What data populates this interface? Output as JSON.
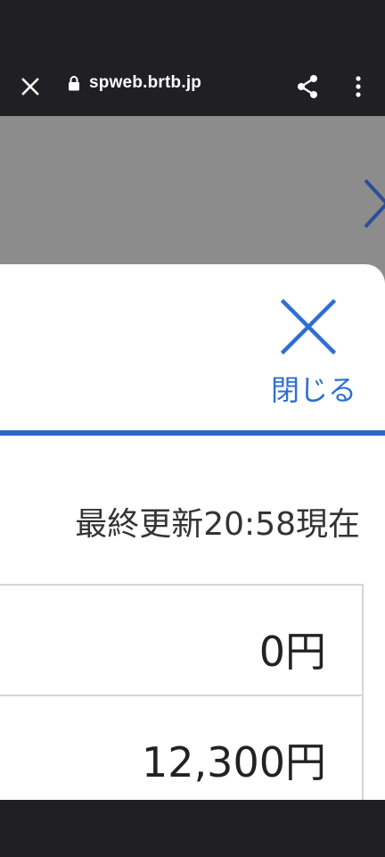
{
  "browser": {
    "url": "spweb.brtb.jp",
    "close_icon": "close-icon",
    "lock_icon": "lock-icon",
    "share_icon": "share-icon",
    "menu_icon": "more-vert-icon"
  },
  "background": {
    "chevron_icon": "chevron-right-icon"
  },
  "sheet": {
    "close_label": "閉じる",
    "last_updated": "最終更新20:58現在",
    "rows": [
      {
        "amount": "0円"
      },
      {
        "amount": "12,300円"
      }
    ]
  },
  "colors": {
    "accent": "#2f66c9",
    "chrome": "#1f1f24",
    "overlay": "#8c8c8c"
  }
}
